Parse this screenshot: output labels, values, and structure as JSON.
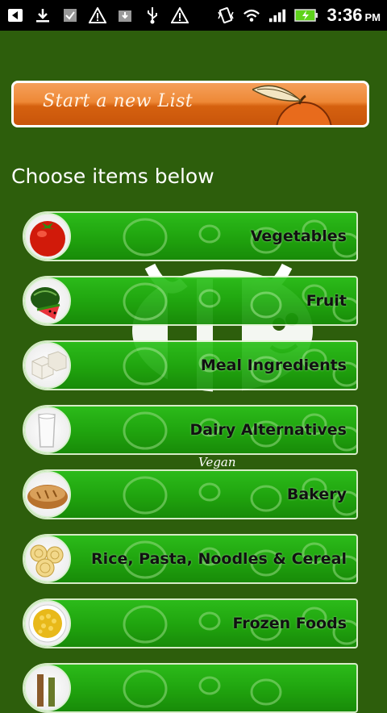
{
  "status_bar": {
    "time": "3:36",
    "ampm": "PM",
    "left_icons": [
      "back-arrow-icon",
      "download-icon",
      "checkbox-icon",
      "warning-icon",
      "download-box-icon",
      "usb-icon",
      "warning-icon"
    ],
    "right_icons": [
      "vibrate-icon",
      "wifi-icon",
      "signal-icon",
      "battery-icon"
    ]
  },
  "start_banner": {
    "label": "Start a new List"
  },
  "heading": "Choose items below",
  "background": {
    "vegan_label": "Vegan"
  },
  "categories": [
    {
      "label": "Vegetables",
      "icon": "tomato-icon"
    },
    {
      "label": "Fruit",
      "icon": "watermelon-icon"
    },
    {
      "label": "Meal Ingredients",
      "icon": "tofu-icon"
    },
    {
      "label": "Dairy Alternatives",
      "icon": "milk-glass-icon"
    },
    {
      "label": "Bakery",
      "icon": "bread-icon"
    },
    {
      "label": "Rice, Pasta, Noodles & Cereal",
      "icon": "pasta-nest-icon"
    },
    {
      "label": "Frozen Foods",
      "icon": "corn-bowl-icon"
    },
    {
      "label": "",
      "icon": "bottles-icon"
    }
  ],
  "colors": {
    "background": "#2d5e0c",
    "category_bar": "#1fa90f",
    "banner_orange": "#ee8836",
    "status_bar": "#000000",
    "battery_green": "#5ed21b"
  }
}
